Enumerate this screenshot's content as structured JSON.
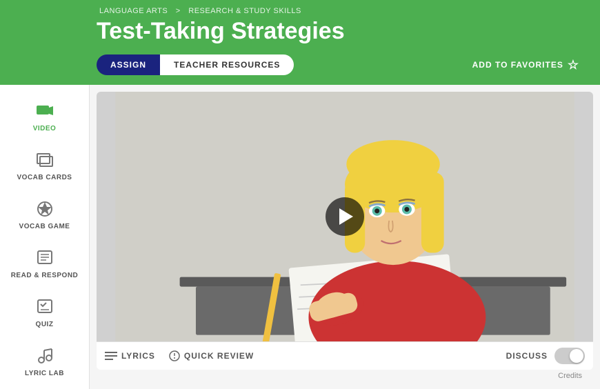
{
  "breadcrumb": {
    "part1": "LANGUAGE ARTS",
    "separator": ">",
    "part2": "RESEARCH & STUDY SKILLS"
  },
  "header": {
    "title": "Test-Taking Strategies",
    "assign_label": "ASSIGN",
    "teacher_resources_label": "TEACHER RESOURCES",
    "add_to_favorites_label": "ADD TO FAVORITES"
  },
  "sidebar": {
    "items": [
      {
        "id": "video",
        "label": "VIDEO",
        "active": true
      },
      {
        "id": "vocab-cards",
        "label": "VOCAB CARDS",
        "active": false
      },
      {
        "id": "vocab-game",
        "label": "VOCAB GAME",
        "active": false
      },
      {
        "id": "read-respond",
        "label": "READ & RESPOND",
        "active": false
      },
      {
        "id": "quiz",
        "label": "QUIZ",
        "active": false
      },
      {
        "id": "lyric-lab",
        "label": "LYRIC LAB",
        "active": false
      }
    ]
  },
  "bottom_bar": {
    "lyrics_label": "LYRICS",
    "quick_review_label": "QUICK REVIEW",
    "discuss_label": "DISCUSS"
  },
  "credits": "Credits"
}
